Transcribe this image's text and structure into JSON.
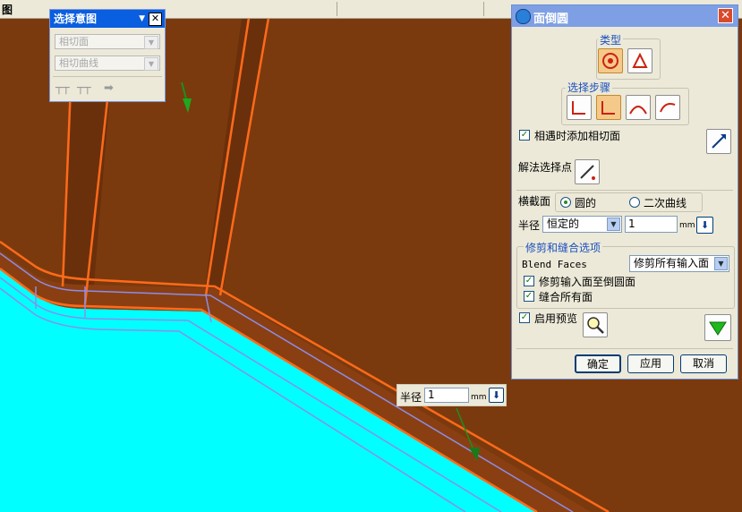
{
  "menubar": {
    "title": "图"
  },
  "intent_toolbar": {
    "title": "选择意图",
    "combo1": "相切面",
    "combo2": "相切曲线"
  },
  "dialog": {
    "title": "面倒圆",
    "type_label": "类型",
    "steps_label": "选择步骤",
    "add_tangent_label": "相遇时添加相切面",
    "add_tangent_checked": true,
    "solve_point_label": "解法选择点",
    "section_label": "横截面",
    "section_opt1": "圆的",
    "section_opt2": "二次曲线",
    "section_selected": "圆的",
    "radius_label": "半径",
    "radius_mode": "恒定的",
    "radius_value": "1",
    "unit": "mm",
    "trim_group_label": "修剪和缝合选项",
    "blend_faces_label": "Blend Faces",
    "blend_faces_value": "修剪所有输入面",
    "trim_input_label": "修剪输入面至倒圆面",
    "trim_input_checked": true,
    "sew_all_label": "缝合所有面",
    "sew_all_checked": true,
    "preview_label": "启用预览",
    "preview_checked": true,
    "ok_label": "确定",
    "apply_label": "应用",
    "cancel_label": "取消"
  },
  "on_screen_radius": {
    "label": "半径",
    "value": "1",
    "unit": "mm"
  },
  "colors": {
    "solid_brown": "#7b3a0e",
    "face_cyan": "#00ffff",
    "edge_orange": "#ff6a1a",
    "edge_lavender": "#8a8ee8",
    "title_blue": "#0a5ee0",
    "dialog_bg": "#ece9d8"
  }
}
